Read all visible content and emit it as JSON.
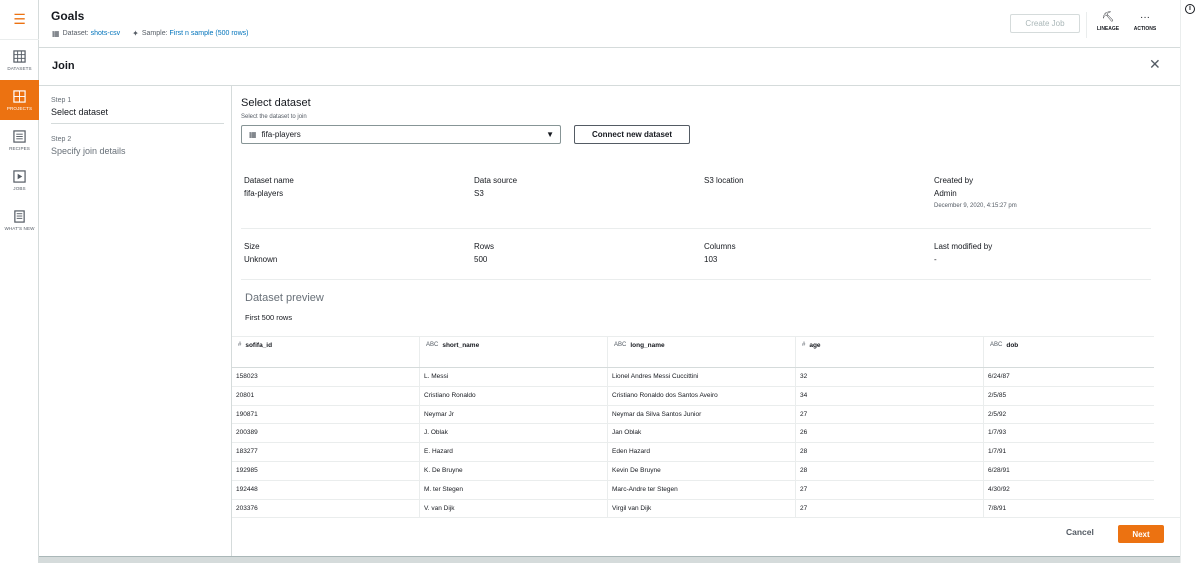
{
  "nav": {
    "items": [
      {
        "label": "DATASETS",
        "icon": "table-icon"
      },
      {
        "label": "PROJECTS",
        "icon": "grid-icon"
      },
      {
        "label": "RECIPES",
        "icon": "list-icon"
      },
      {
        "label": "JOBS",
        "icon": "play-icon"
      },
      {
        "label": "WHAT'S NEW",
        "icon": "document-icon"
      }
    ],
    "active": "PROJECTS",
    "accent": "#ec7211"
  },
  "header": {
    "title": "Goals",
    "dataset_label": "Dataset:",
    "dataset_value": "shots-csv",
    "sample_label": "Sample:",
    "sample_value": "First n sample (500 rows)",
    "create_job": "Create Job",
    "lineage": "LINEAGE",
    "actions": "ACTIONS"
  },
  "join": {
    "title": "Join",
    "steps": [
      {
        "num": "Step 1",
        "name": "Select dataset"
      },
      {
        "num": "Step 2",
        "name": "Specify join details"
      }
    ]
  },
  "select": {
    "title": "Select dataset",
    "subtitle": "Select the dataset to join",
    "selected": "fifa-players",
    "connect_button": "Connect new dataset"
  },
  "details": {
    "dataset_name_label": "Dataset name",
    "dataset_name": "fifa-players",
    "data_source_label": "Data source",
    "data_source": "S3",
    "s3_location_label": "S3 location",
    "created_by_label": "Created by",
    "created_by": "Admin",
    "created_at": "December 9, 2020, 4:15:27 pm",
    "size_label": "Size",
    "size": "Unknown",
    "rows_label": "Rows",
    "rows": "500",
    "columns_label": "Columns",
    "columns": "103",
    "last_modified_label": "Last modified by",
    "last_modified": "-"
  },
  "preview": {
    "title": "Dataset preview",
    "subtitle": "First 500 rows",
    "columns": [
      {
        "type": "#",
        "name": "sofifa_id"
      },
      {
        "type": "ABC",
        "name": "short_name"
      },
      {
        "type": "ABC",
        "name": "long_name"
      },
      {
        "type": "#",
        "name": "age"
      },
      {
        "type": "ABC",
        "name": "dob"
      }
    ],
    "rows": [
      [
        "158023",
        "L. Messi",
        "Lionel Andres Messi Cuccittini",
        "32",
        "6/24/87"
      ],
      [
        "20801",
        "Cristiano Ronaldo",
        "Cristiano Ronaldo dos Santos Aveiro",
        "34",
        "2/5/85"
      ],
      [
        "190871",
        "Neymar Jr",
        "Neymar da Silva Santos Junior",
        "27",
        "2/5/92"
      ],
      [
        "200389",
        "J. Oblak",
        "Jan Oblak",
        "26",
        "1/7/93"
      ],
      [
        "183277",
        "E. Hazard",
        "Eden Hazard",
        "28",
        "1/7/91"
      ],
      [
        "192985",
        "K. De Bruyne",
        "Kevin De Bruyne",
        "28",
        "6/28/91"
      ],
      [
        "192448",
        "M. ter Stegen",
        "Marc-Andre ter Stegen",
        "27",
        "4/30/92"
      ],
      [
        "203376",
        "V. van Dijk",
        "Virgil van Dijk",
        "27",
        "7/8/91"
      ]
    ]
  },
  "footer": {
    "cancel": "Cancel",
    "next": "Next"
  }
}
